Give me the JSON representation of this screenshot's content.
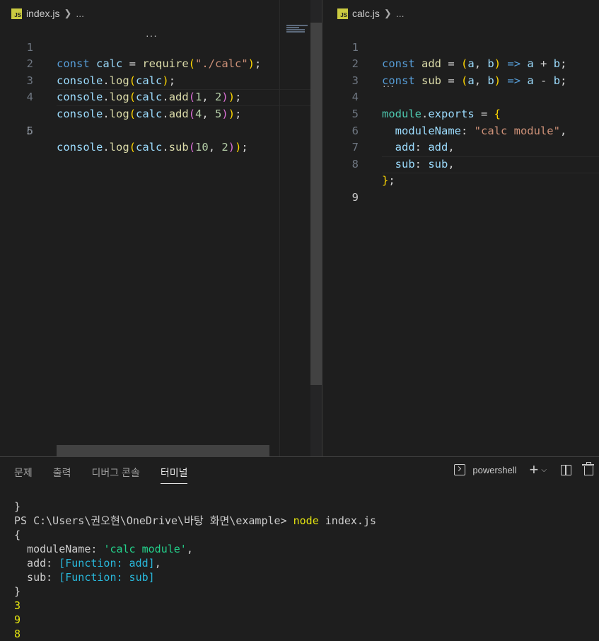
{
  "editor_left": {
    "file_name": "index.js",
    "breadcrumb_more": "...",
    "icon_label": "JS",
    "lines": [
      {
        "n": "1"
      },
      {
        "n": "2"
      },
      {
        "n": "3"
      },
      {
        "n": "4"
      },
      {
        "n": "5"
      },
      {
        "n": "6"
      }
    ],
    "code": {
      "l1": {
        "kw": "const",
        "name": " calc",
        "eq": " = ",
        "fn": "require",
        "p1": "(",
        "str": "\"./calc\"",
        "p2": ")",
        ";": ";"
      },
      "l2": {
        "obj": "console",
        "dot": ".",
        "fn": "log",
        "p1": "(",
        "arg": "calc",
        "p2": ")",
        "end": ";"
      },
      "l3": {
        "obj": "console",
        "dot": ".",
        "fn": "log",
        "p1": "(",
        "arg": "calc",
        "dot2": ".",
        "fn2": "add",
        "p2": "(",
        "a": "1",
        "comma": ", ",
        "b": "2",
        "p3": ")",
        "p4": ")",
        "end": ";"
      },
      "l4": {
        "obj": "console",
        "dot": ".",
        "fn": "log",
        "p1": "(",
        "arg": "calc",
        "dot2": ".",
        "fn2": "add",
        "p2": "(",
        "a": "4",
        "comma": ", ",
        "b": "5",
        "p3": ")",
        "p4": ")",
        "end": ";"
      },
      "l5": {
        "obj": "console",
        "dot": ".",
        "fn": "log",
        "p1": "(",
        "arg": "calc",
        "dot2": ".",
        "fn2": "sub",
        "p2": "(",
        "a": "10",
        "comma": ", ",
        "b": "2",
        "p3": ")",
        "p4": ")",
        "end": ";"
      }
    }
  },
  "editor_right": {
    "file_name": "calc.js",
    "breadcrumb_more": "...",
    "icon_label": "JS",
    "lines": [
      {
        "n": "1"
      },
      {
        "n": "2"
      },
      {
        "n": "3"
      },
      {
        "n": "4"
      },
      {
        "n": "5"
      },
      {
        "n": "6"
      },
      {
        "n": "7"
      },
      {
        "n": "8"
      },
      {
        "n": "9"
      }
    ],
    "code": {
      "l1": {
        "kw": "const",
        "name": " add",
        "eq": " = ",
        "p1": "(",
        "a": "a",
        "comma": ", ",
        "b": "b",
        "p2": ")",
        "arrow": " => ",
        "a2": "a",
        "plus": " + ",
        "b2": "b",
        "end": ";"
      },
      "l2": {
        "kw": "const",
        "name": " sub",
        "eq": " = ",
        "p1": "(",
        "a": "a",
        "comma": ", ",
        "b": "b",
        "p2": ")",
        "arrow": " => ",
        "a2": "a",
        "minus": " - ",
        "b2": "b",
        "end": ";"
      },
      "l4": {
        "mod": "module",
        "dot": ".",
        "exp": "exports",
        "eq": " = ",
        "brace": "{"
      },
      "l5": {
        "key": "  moduleName",
        "colon": ": ",
        "str": "\"calc module\"",
        "comma": ","
      },
      "l6": {
        "key": "  add",
        "colon": ": ",
        "val": "add",
        "comma": ","
      },
      "l7": {
        "key": "  sub",
        "colon": ": ",
        "val": "sub",
        "comma": ","
      },
      "l8": {
        "brace": "}",
        "end": ";"
      }
    }
  },
  "panel": {
    "tabs": [
      "문제",
      "출력",
      "디버그 콘솔",
      "터미널"
    ],
    "active_tab": "터미널",
    "shell_name": "powershell"
  },
  "terminal": {
    "l0": "}",
    "prompt": "PS C:\\Users\\권오현\\OneDrive\\바탕 화면\\example> ",
    "cmd": "node",
    "cmd_arg": " index.js",
    "l2": "{",
    "k1": "  moduleName: ",
    "v1": "'calc module'",
    "c1": ",",
    "k2": "  add: ",
    "v2": "[Function: add]",
    "c2": ",",
    "k3": "  sub: ",
    "v3": "[Function: sub]",
    "l6": "}",
    "o1": "3",
    "o2": "9",
    "o3": "8"
  }
}
